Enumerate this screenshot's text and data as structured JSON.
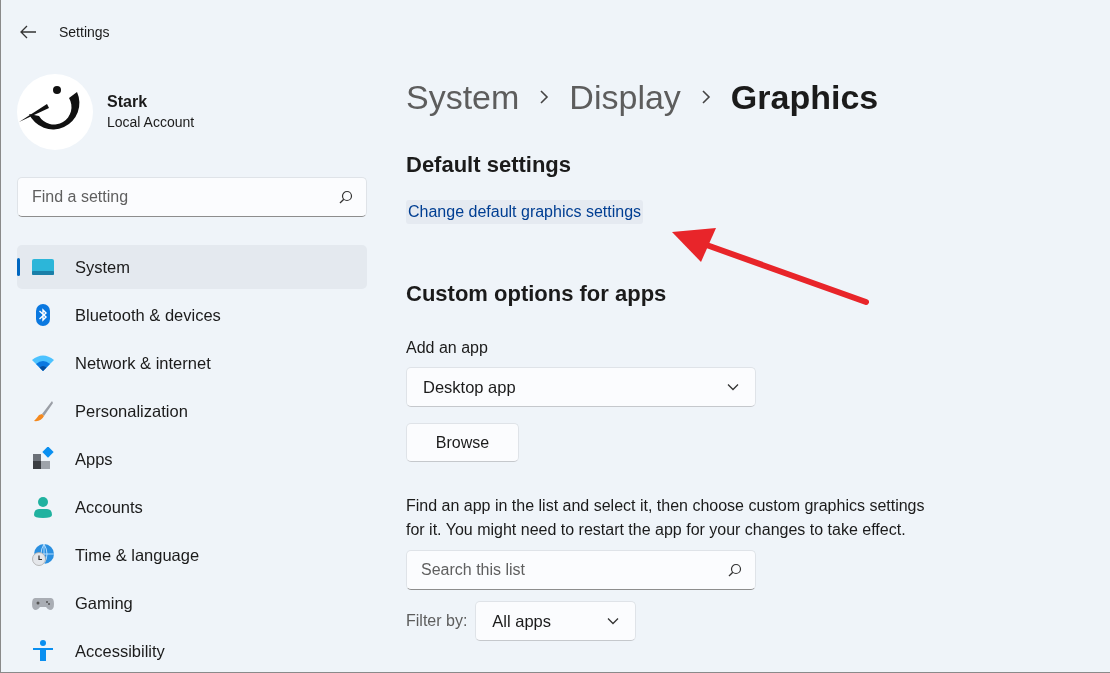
{
  "window": {
    "title": "Settings"
  },
  "account": {
    "name": "Stark",
    "type": "Local Account"
  },
  "sidebar": {
    "search": {
      "placeholder": "Find a setting"
    },
    "items": [
      {
        "label": "System",
        "kind": "system",
        "selected": true
      },
      {
        "label": "Bluetooth & devices",
        "kind": "bluetooth",
        "selected": false
      },
      {
        "label": "Network & internet",
        "kind": "network",
        "selected": false
      },
      {
        "label": "Personalization",
        "kind": "brush",
        "selected": false
      },
      {
        "label": "Apps",
        "kind": "apps",
        "selected": false
      },
      {
        "label": "Accounts",
        "kind": "person",
        "selected": false
      },
      {
        "label": "Time & language",
        "kind": "globe",
        "selected": false
      },
      {
        "label": "Gaming",
        "kind": "gamepad",
        "selected": false
      },
      {
        "label": "Accessibility",
        "kind": "accessibility",
        "selected": false
      }
    ]
  },
  "breadcrumb": [
    {
      "label": "System",
      "selected": false
    },
    {
      "label": "Display",
      "selected": false
    },
    {
      "label": "Graphics",
      "selected": true
    }
  ],
  "default_settings": {
    "heading": "Default settings",
    "link": "Change default graphics settings"
  },
  "custom_options": {
    "heading": "Custom options for apps",
    "add_label": "Add an app",
    "app_type": {
      "value": "Desktop app"
    },
    "browse_button": "Browse",
    "description": "Find an app in the list and select it, then choose custom graphics settings for it. You might need to restart the app for your changes to take effect.",
    "search": {
      "placeholder": "Search this list"
    },
    "filter": {
      "label": "Filter by:",
      "value": "All apps"
    }
  }
}
